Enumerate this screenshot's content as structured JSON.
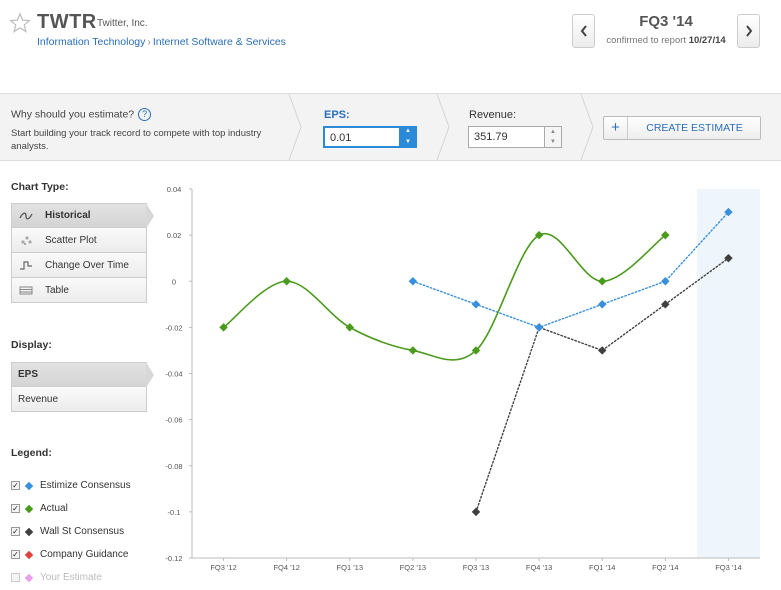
{
  "header": {
    "ticker": "TWTR",
    "company": "Twitter, Inc.",
    "sector": "Information Technology",
    "industry": "Internet Software & Services",
    "quarter": "FQ3 '14",
    "confirm_prefix": "confirmed to report",
    "confirm_date": "10/27/14",
    "prev_icon": "chevron-left-icon",
    "next_icon": "chevron-right-icon"
  },
  "estimate": {
    "why_label": "Why should you estimate?",
    "help_glyph": "?",
    "start_text": "Start building your track record to compete with top industry analysts.",
    "eps_label": "EPS:",
    "eps_value": "0.01",
    "revenue_label": "Revenue:",
    "revenue_value": "351.79",
    "create_plus": "+",
    "create_label": "CREATE ESTIMATE"
  },
  "chart_type": {
    "title": "Chart Type:",
    "items": [
      {
        "label": "Historical",
        "icon": "wave-icon",
        "active": true
      },
      {
        "label": "Scatter Plot",
        "icon": "scatter-icon",
        "active": false
      },
      {
        "label": "Change Over Time",
        "icon": "step-icon",
        "active": false
      },
      {
        "label": "Table",
        "icon": "table-icon",
        "active": false
      }
    ]
  },
  "display": {
    "title": "Display:",
    "items": [
      {
        "label": "EPS",
        "active": true
      },
      {
        "label": "Revenue",
        "active": false
      }
    ]
  },
  "legend": {
    "title": "Legend:",
    "items": [
      {
        "label": "Estimize Consensus",
        "color": "#3a8fdc",
        "checked": true
      },
      {
        "label": "Actual",
        "color": "#4a9a1c",
        "checked": true
      },
      {
        "label": "Wall St Consensus",
        "color": "#404040",
        "checked": true
      },
      {
        "label": "Company Guidance",
        "color": "#e04040",
        "checked": true
      },
      {
        "label": "Your Estimate",
        "color": "#e9a0ea",
        "checked": false
      }
    ]
  },
  "chart_data": {
    "type": "line",
    "categories": [
      "FQ3 '12",
      "FQ4 '12",
      "FQ1 '13",
      "FQ2 '13",
      "FQ3 '13",
      "FQ4 '13",
      "FQ1 '14",
      "FQ2 '14",
      "FQ3 '14"
    ],
    "ylim": [
      -0.12,
      0.04
    ],
    "yticks": [
      "0.04",
      "0.02",
      "0",
      "-0.02",
      "-0.04",
      "-0.06",
      "-0.08",
      "-0.1",
      "-0.12"
    ],
    "highlight_category": "FQ3 '14",
    "series": [
      {
        "name": "Actual",
        "color": "#4a9a1c",
        "style": "solid",
        "smooth": true,
        "values": [
          -0.02,
          0.0,
          -0.02,
          -0.03,
          -0.03,
          0.02,
          0.0,
          0.02,
          null
        ]
      },
      {
        "name": "Estimize Consensus",
        "color": "#3a8fdc",
        "style": "dotted",
        "smooth": false,
        "values": [
          null,
          null,
          null,
          0.0,
          -0.01,
          -0.02,
          -0.01,
          0.0,
          0.03
        ]
      },
      {
        "name": "Wall St Consensus",
        "color": "#404040",
        "style": "dotted",
        "smooth": false,
        "values": [
          null,
          null,
          null,
          null,
          -0.1,
          -0.02,
          -0.03,
          -0.01,
          0.01
        ]
      }
    ]
  }
}
